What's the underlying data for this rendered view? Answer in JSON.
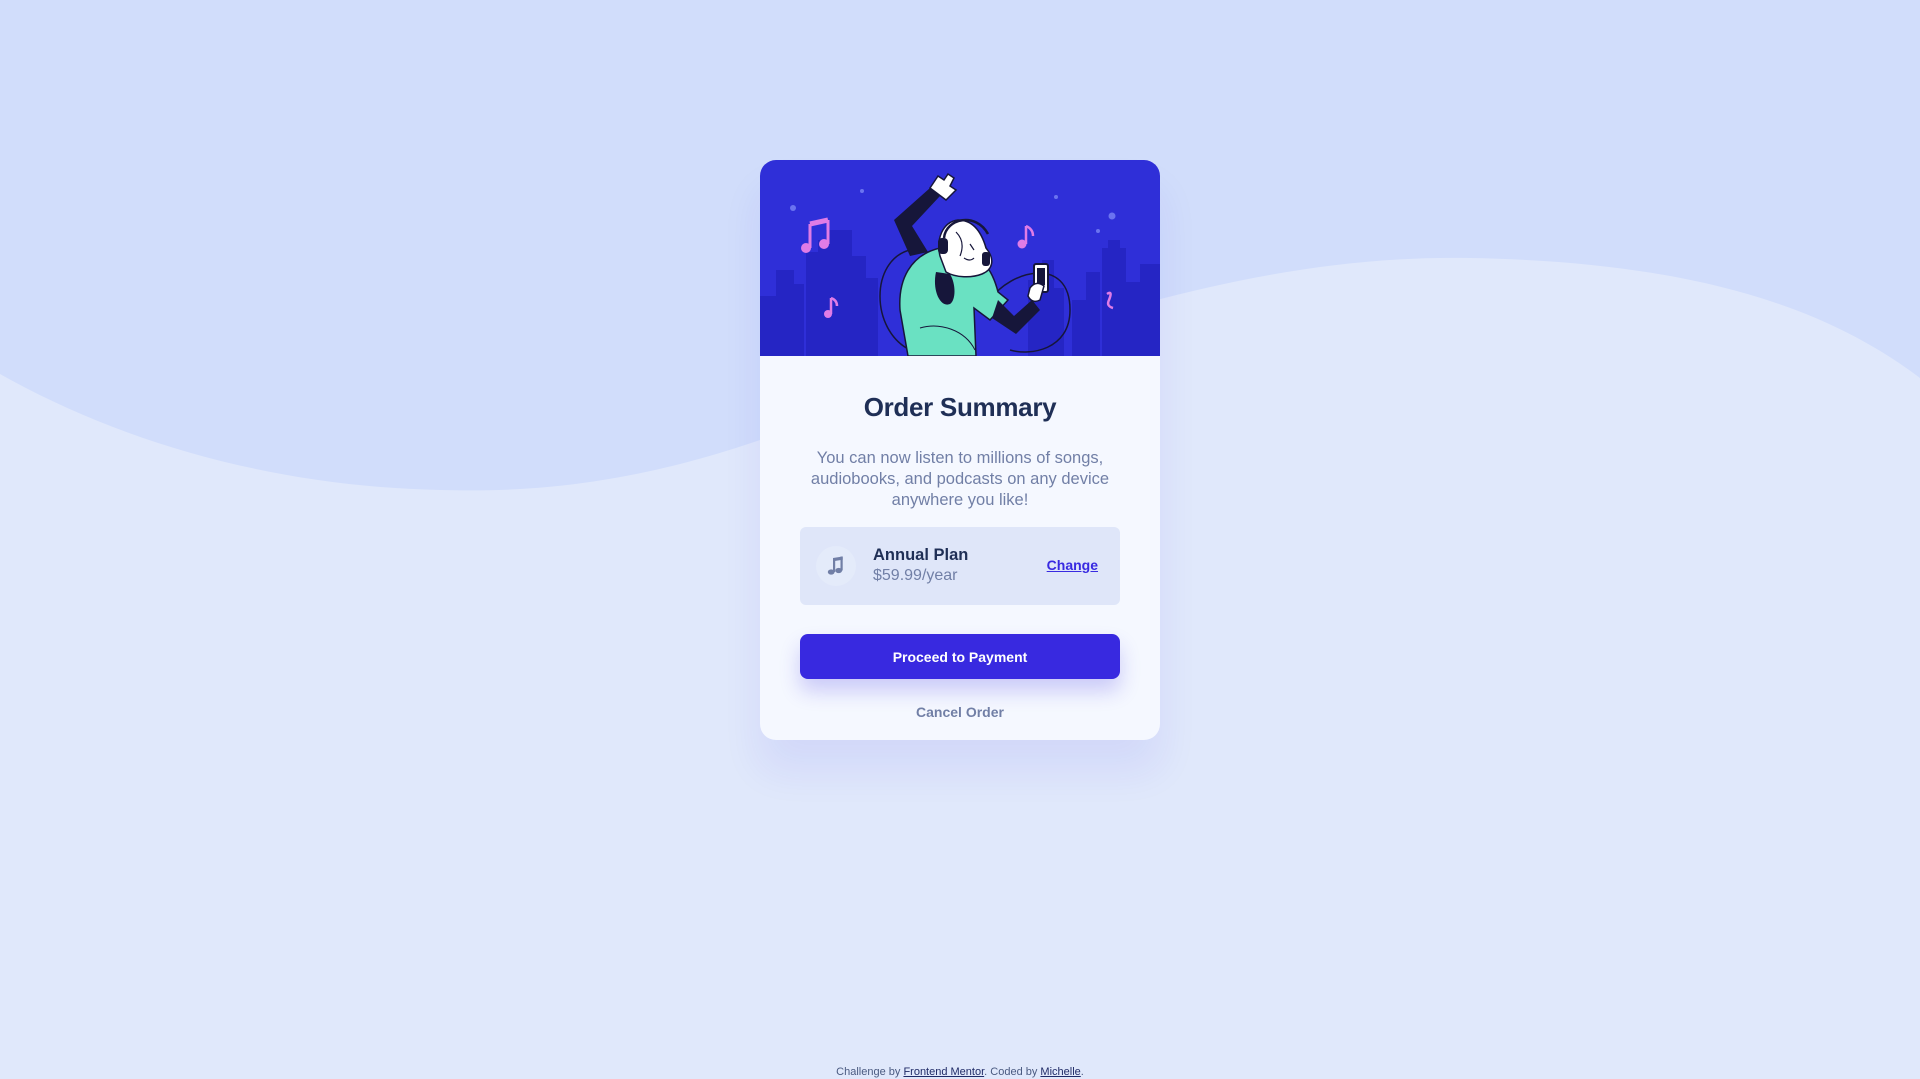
{
  "card": {
    "title": "Order Summary",
    "description": "You can now listen to millions of songs, audiobooks, and podcasts on any device anywhere you like!",
    "illustration_icon": "music-listener-illustration"
  },
  "plan": {
    "icon": "music-note-icon",
    "name": "Annual Plan",
    "price": "$59.99/year",
    "change_label": "Change"
  },
  "actions": {
    "proceed_label": "Proceed to Payment",
    "cancel_label": "Cancel Order"
  },
  "attribution": {
    "prefix": "Challenge by",
    "frontend_mentor": "Frontend Mentor",
    "middle": ". Coded by",
    "author": "Michelle",
    "suffix": "."
  },
  "colors": {
    "page_background": "#e0e8fb",
    "wave": "#d1ddfb",
    "card_background": "#f5f8ff",
    "hero_background": "#2f2fd8",
    "accent": "#3829e0",
    "title_text": "#1f2f56",
    "body_text": "#717fa6",
    "plan_background": "#dfe6f9"
  }
}
